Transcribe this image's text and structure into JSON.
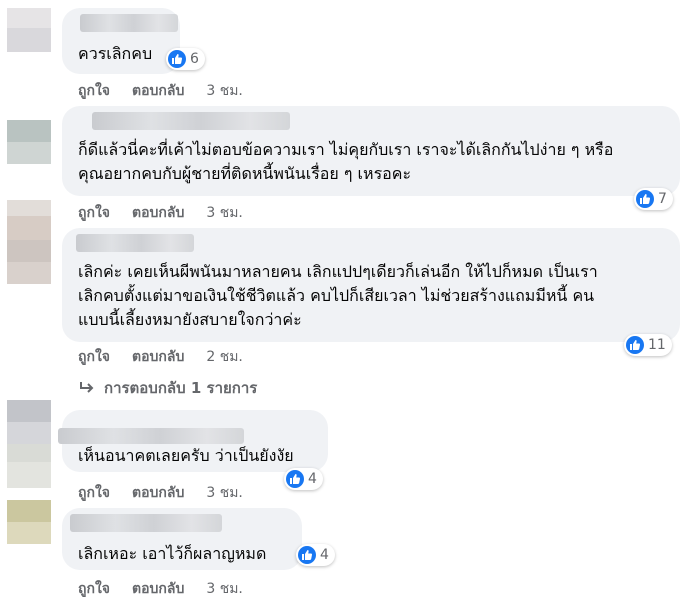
{
  "like_label": "ถูกใจ",
  "reply_label": "ตอบกลับ",
  "comments": [
    {
      "text": [
        "ควรเลิกคบ"
      ],
      "likes": "6",
      "time": "3 ชม."
    },
    {
      "text": [
        "ก็ดีแล้วนี่คะที่เค้าไม่ตอบข้อความเรา ไม่คุยกับเรา เราจะได้เลิกกันไปง่าย ๆ หรือ",
        "คุณอยากคบกับผู้ชายที่ติดหนี้พนันเรื่อย ๆ เหรอคะ"
      ],
      "likes": "7",
      "time": "3 ชม."
    },
    {
      "text": [
        "เลิกค่ะ เคยเห็นผีพนันมาหลายคน เลิกแปปๆเดียวก็เล่นอีก ให้ไปก็หมด เป็นเรา",
        "เลิกคบตั้งแต่มาขอเงินใช้ชีวิตแล้ว คบไปก็เสียเวลา ไม่ช่วยสร้างแถมมีหนี้ คน",
        "แบบนี้เลี้ยงหมายังสบายใจกว่าค่ะ"
      ],
      "likes": "11",
      "time": "2 ชม."
    },
    {
      "text": [
        "เห็นอนาคตเลยครับ ว่าเป็นยังงัย"
      ],
      "likes": "4",
      "time": "3 ชม."
    },
    {
      "text": [
        "เลิกเหอะ เอาไว้ก็ผลาญหมด"
      ],
      "likes": "4",
      "time": "3 ชม."
    }
  ],
  "replies_link": "การตอบกลับ 1 รายการ",
  "colors": {
    "bubble": "#f0f2f5",
    "like_blue": "#1877f2",
    "meta_gray": "#65676b",
    "text": "#050505"
  }
}
